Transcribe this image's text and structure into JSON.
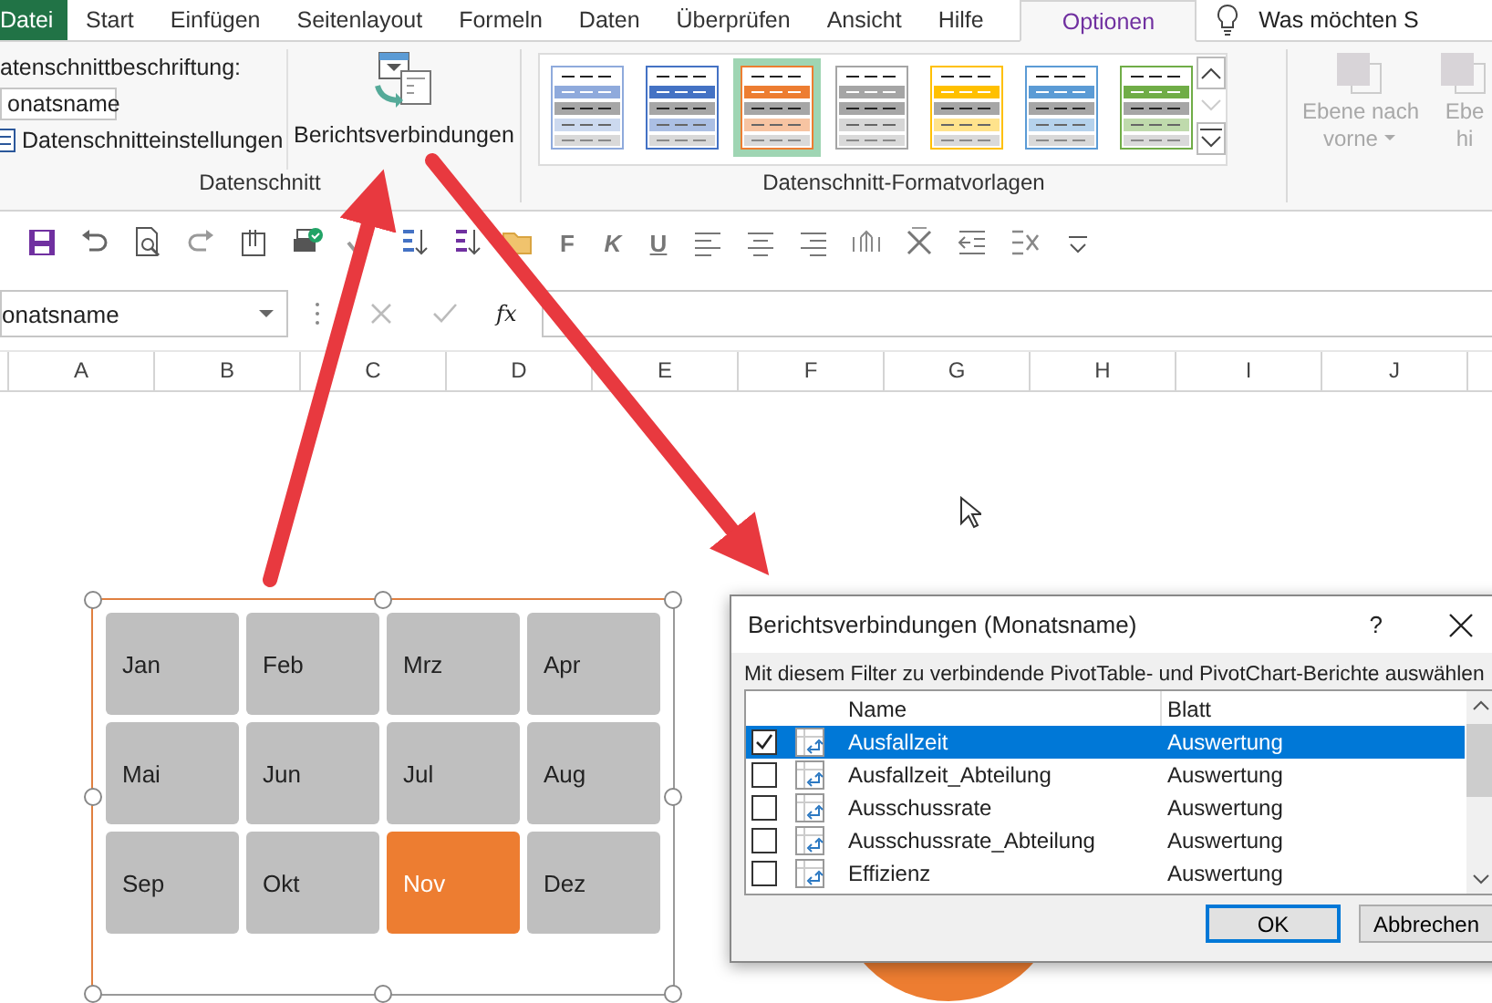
{
  "ribbon_tabs": [
    {
      "label": "Datei",
      "kind": "file",
      "selected": false
    },
    {
      "label": "Start",
      "kind": "tab",
      "selected": false
    },
    {
      "label": "Einfügen",
      "kind": "tab",
      "selected": false
    },
    {
      "label": "Seitenlayout",
      "kind": "tab",
      "selected": false
    },
    {
      "label": "Formeln",
      "kind": "tab",
      "selected": false
    },
    {
      "label": "Daten",
      "kind": "tab",
      "selected": false
    },
    {
      "label": "Überprüfen",
      "kind": "tab",
      "selected": false
    },
    {
      "label": "Ansicht",
      "kind": "tab",
      "selected": false
    },
    {
      "label": "Hilfe",
      "kind": "tab",
      "selected": false
    },
    {
      "label": "Optionen",
      "kind": "tab",
      "selected": true
    }
  ],
  "tell_me": {
    "placeholder": "Was möchten S"
  },
  "slicer_group": {
    "caption_label": "atenschnittbeschriftung:",
    "caption_value": "onatsname",
    "settings_label": "Datenschnitteinstellungen",
    "connections_label": "Berichtsverbindungen",
    "title": "Datenschnitt"
  },
  "styles_group": {
    "title": "Datenschnitt-Formatvorlagen",
    "styles": [
      {
        "color": "#8faadc",
        "selected": false
      },
      {
        "color": "#4472c4",
        "selected": false
      },
      {
        "color": "#ed7d31",
        "selected": true
      },
      {
        "color": "#a5a5a5",
        "selected": false
      },
      {
        "color": "#ffc000",
        "selected": false
      },
      {
        "color": "#5b9bd5",
        "selected": false
      },
      {
        "color": "#70ad47",
        "selected": false
      }
    ]
  },
  "arrange_group": [
    {
      "line1": "Ebene nach",
      "line2": "vorne",
      "disabled": true
    },
    {
      "line1": "Ebe",
      "line2": "hi",
      "disabled": true
    }
  ],
  "format_keys": [
    "F",
    "K",
    "U"
  ],
  "name_box": {
    "value": "onatsname"
  },
  "formula_bar": {
    "function_label": "fx"
  },
  "columns": [
    "A",
    "B",
    "C",
    "D",
    "E",
    "F",
    "G",
    "H",
    "I",
    "J"
  ],
  "slicer": {
    "items": [
      {
        "label": "Jan",
        "selected": false
      },
      {
        "label": "Feb",
        "selected": false
      },
      {
        "label": "Mrz",
        "selected": false
      },
      {
        "label": "Apr",
        "selected": false
      },
      {
        "label": "Mai",
        "selected": false
      },
      {
        "label": "Jun",
        "selected": false
      },
      {
        "label": "Jul",
        "selected": false
      },
      {
        "label": "Aug",
        "selected": false
      },
      {
        "label": "Sep",
        "selected": false
      },
      {
        "label": "Okt",
        "selected": false
      },
      {
        "label": "Nov",
        "selected": true
      },
      {
        "label": "Dez",
        "selected": false
      }
    ]
  },
  "dialog": {
    "title": "Berichtsverbindungen (Monatsname)",
    "help": "?",
    "instruction": "Mit diesem Filter zu verbindende PivotTable- und PivotChart-Berichte auswählen",
    "columns": [
      "Name",
      "Blatt"
    ],
    "rows": [
      {
        "name": "Ausfallzeit",
        "sheet": "Auswertung",
        "checked": true,
        "selected": true
      },
      {
        "name": "Ausfallzeit_Abteilung",
        "sheet": "Auswertung",
        "checked": false,
        "selected": false
      },
      {
        "name": "Ausschussrate",
        "sheet": "Auswertung",
        "checked": false,
        "selected": false
      },
      {
        "name": "Ausschussrate_Abteilung",
        "sheet": "Auswertung",
        "checked": false,
        "selected": false
      },
      {
        "name": "Effizienz",
        "sheet": "Auswertung",
        "checked": false,
        "selected": false
      }
    ],
    "buttons": [
      {
        "label": "OK",
        "default": true
      },
      {
        "label": "Abbrechen",
        "default": false
      }
    ]
  }
}
